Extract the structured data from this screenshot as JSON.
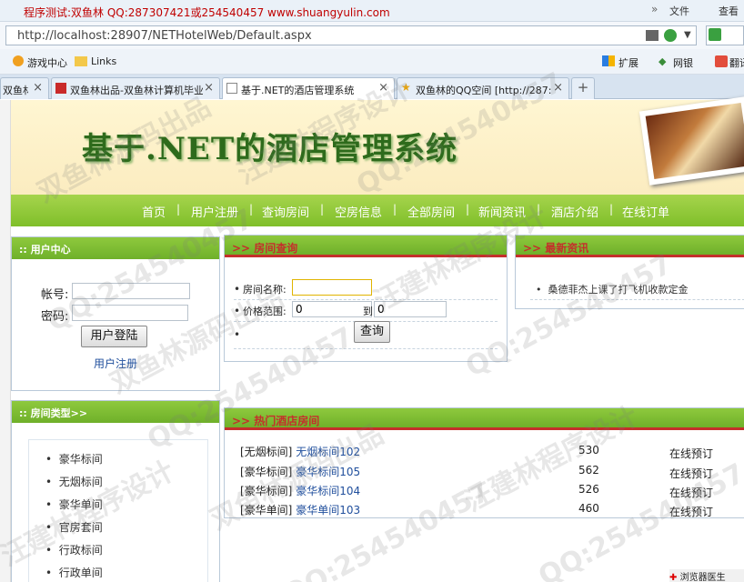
{
  "browser": {
    "title": "程序测试:双鱼林 QQ:287307421或254540457 www.shuangyulin.com",
    "menu": [
      "文件",
      "查看"
    ],
    "url": "http://localhost:28907/NETHotelWeb/Default.aspx",
    "bookmarks": [
      "游戏中心",
      "Links"
    ],
    "right_tools": [
      "扩展",
      "网银",
      "翻译"
    ],
    "tabs": [
      {
        "label": "双鱼林"
      },
      {
        "label": "双鱼林出品-双鱼林计算机毕业"
      },
      {
        "label": "基于.NET的酒店管理系统"
      },
      {
        "label": "双鱼林的QQ空间 [http://287:"
      }
    ],
    "status": "浏览器医生"
  },
  "site": {
    "banner_title": "基于.NET的酒店管理系统",
    "nav": [
      "首页",
      "用户注册",
      "查询房间",
      "空房信息",
      "全部房间",
      "新闻资讯",
      "酒店介绍",
      "在线订单"
    ]
  },
  "user_center": {
    "title": "用户中心",
    "account_label": "帐号:",
    "password_label": "密码:",
    "login_button": "用户登陆",
    "register_link": "用户注册"
  },
  "room_types": {
    "title": "房间类型>>",
    "items": [
      "豪华标间",
      "无烟标间",
      "豪华单间",
      "官房套间",
      "行政标间",
      "行政单间"
    ]
  },
  "room_search": {
    "title": "房间查询",
    "name_label": "房间名称:",
    "name_value": "",
    "price_label": "价格范围:",
    "price_from": "0",
    "to_label": "到",
    "price_to": "0",
    "search_button": "查询"
  },
  "news": {
    "title": "最新资讯",
    "items": [
      "桑德菲杰上课了打飞机收款定金"
    ]
  },
  "hot_rooms": {
    "title": "热门酒店房间",
    "rows": [
      {
        "type": "[无烟标间]",
        "name": "无烟标间102",
        "price": "530",
        "action": "在线预订"
      },
      {
        "type": "[豪华标间]",
        "name": "豪华标间105",
        "price": "562",
        "action": "在线预订"
      },
      {
        "type": "[豪华标间]",
        "name": "豪华标间104",
        "price": "526",
        "action": "在线预订"
      },
      {
        "type": "[豪华单间]",
        "name": "豪华单间103",
        "price": "460",
        "action": "在线预订"
      }
    ]
  },
  "watermarks": [
    "双鱼林源码出品",
    "汪建林程序设计",
    "QQ:254540457"
  ]
}
